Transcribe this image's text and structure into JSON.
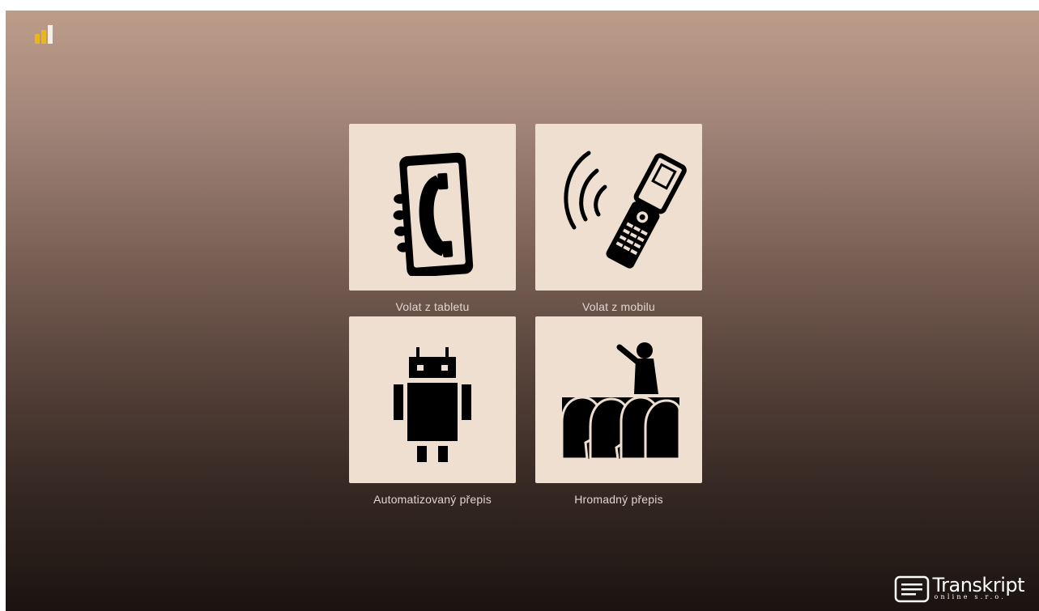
{
  "status_bar": {
    "signal_icon": "signal-bars-icon",
    "accent_color": "#e9b61c"
  },
  "tiles": [
    {
      "label": "Volat z tabletu",
      "icon": "tablet-call-icon"
    },
    {
      "label": "Volat z mobilu",
      "icon": "mobile-phone-call-icon"
    },
    {
      "label": "Automatizovaný přepis",
      "icon": "android-robot-icon"
    },
    {
      "label": "Hromadný přepis",
      "icon": "crowd-speaker-icon"
    }
  ],
  "tile_color": "#efdfd1",
  "logo": {
    "name": "Transkript",
    "subtitle": "online s.r.o."
  }
}
